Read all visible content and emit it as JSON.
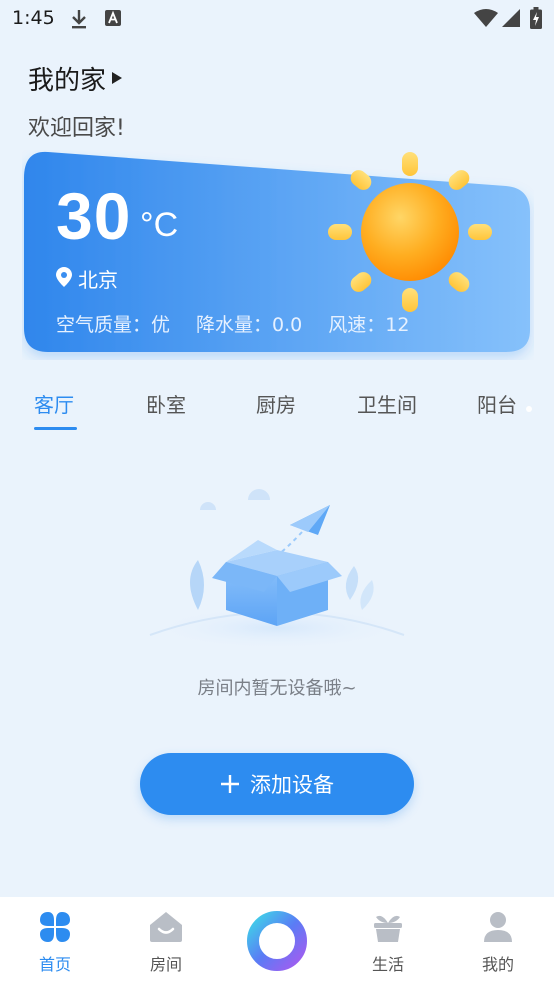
{
  "status_bar": {
    "time": "1:45",
    "icons": [
      "download-icon",
      "font-a-icon",
      "wifi-icon",
      "signal-icon",
      "battery-charging-icon"
    ]
  },
  "header": {
    "title": "我的家",
    "welcome": "欢迎回家!"
  },
  "weather": {
    "temperature": "30",
    "unit": "°C",
    "city": "北京",
    "air_quality": "空气质量：优",
    "precipitation": "降水量：0.0",
    "wind": "风速：12",
    "icon": "sun-icon"
  },
  "tabs": [
    {
      "label": "客厅",
      "active": true
    },
    {
      "label": "卧室",
      "active": false
    },
    {
      "label": "厨房",
      "active": false
    },
    {
      "label": "卫生间",
      "active": false
    },
    {
      "label": "阳台",
      "active": false
    }
  ],
  "empty_state": {
    "message": "房间内暂无设备哦~",
    "icon": "empty-box-icon"
  },
  "add_device_button": {
    "label": "添加设备",
    "icon": "plus-icon"
  },
  "bottom_nav": {
    "items": [
      {
        "label": "首页",
        "icon": "grid-icon",
        "active": true
      },
      {
        "label": "房间",
        "icon": "house-icon",
        "active": false
      },
      {
        "label": "生活",
        "icon": "plant-icon",
        "active": false
      },
      {
        "label": "我的",
        "icon": "user-icon",
        "active": false
      }
    ],
    "center_icon": "ring-icon"
  },
  "colors": {
    "accent": "#2d8cf0",
    "background": "#eaf3fc",
    "card_start": "#2f86ec",
    "card_end": "#86c1fb"
  }
}
